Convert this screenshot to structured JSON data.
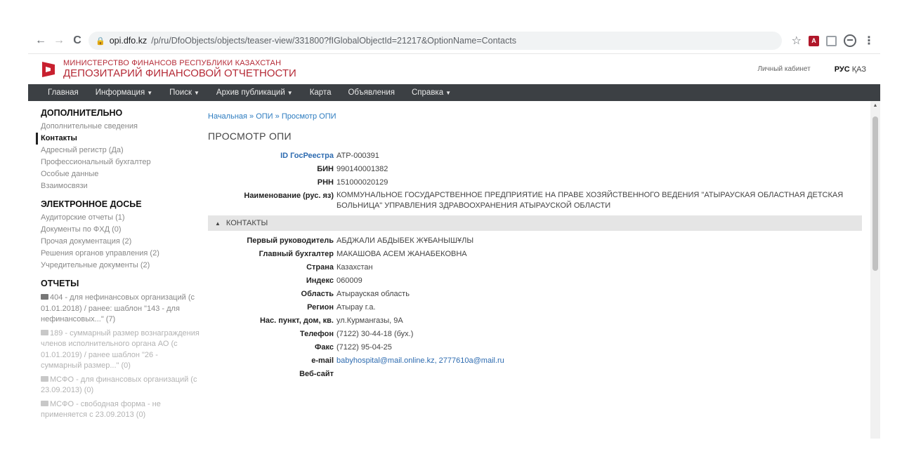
{
  "browser": {
    "url_host": "opi.dfo.kz",
    "url_path": "/p/ru/DfoObjects/objects/teaser-view/331800?fIGlobalObjectId=21217&OptionName=Contacts",
    "back_glyph": "←",
    "forward_glyph": "→",
    "reload_glyph": "C",
    "star_glyph": "☆",
    "kebab_glyph": "⋮"
  },
  "header": {
    "ministry": "МИНИСТЕРСТВО ФИНАНСОВ РЕСПУБЛИКИ КАЗАХСТАН",
    "depository": "ДЕПОЗИТАРИЙ ФИНАНСОВОЙ ОТЧЕТНОСТИ",
    "cabinet": "Личный кабинет",
    "lang_ru": "РУС",
    "lang_kz": "ҚАЗ",
    "brand_color": "#b52a36"
  },
  "menu": {
    "home": "Главная",
    "info": "Информация",
    "search": "Поиск",
    "archive": "Архив публикаций",
    "map": "Карта",
    "ads": "Объявления",
    "help": "Справка",
    "bg_color": "#3c4044"
  },
  "sidebar": {
    "additional_title": "ДОПОЛНИТЕЛЬНО",
    "additional_items": [
      "Дополнительные сведения",
      "Контакты",
      "Адресный регистр (Да)",
      "Профессиональный бухгалтер",
      "Особые данные",
      "Взаимосвязи"
    ],
    "dossier_title": "ЭЛЕКТРОННОЕ ДОСЬЕ",
    "dossier_items": [
      "Аудиторские отчеты (1)",
      "Документы по ФХД (0)",
      "Прочая документация (2)",
      "Решения органов управления (2)",
      "Учредительные документы (2)"
    ],
    "reports_title": "ОТЧЕТЫ",
    "reports": [
      "404 - для нефинансовых организаций (с 01.01.2018) / ранее: шаблон \"143 - для нефинансовых...\" (7)",
      "189 - суммарный размер вознаграждения членов исполнительного органа АО (с 01.01.2019) / ранее шаблон \"26 - суммарный размер...\" (0)",
      "МСФО - для финансовых организаций (с 23.09.2013) (0)",
      "МСФО - свободная форма - не применяется с 23.09.2013 (0)"
    ]
  },
  "main": {
    "breadcrumb": [
      "Начальная",
      "ОПИ",
      "Просмотр ОПИ"
    ],
    "breadcrumb_sep": "»",
    "title": "ПРОСМОТР ОПИ",
    "props": [
      {
        "k": "ID ГосРеестра",
        "v": "АТР-000391"
      },
      {
        "k": "БИН",
        "v": "990140001382"
      },
      {
        "k": "РНН",
        "v": "151000020129"
      },
      {
        "k": "Наименование (рус. яз)",
        "v": "КОММУНАЛЬНОЕ ГОСУДАРСТВЕННОЕ ПРЕДПРИЯТИЕ НА ПРАВЕ ХОЗЯЙСТВЕННОГО ВЕДЕНИЯ \"АТЫРАУСКАЯ ОБЛАСТНАЯ ДЕТСКАЯ БОЛЬНИЦА\" УПРАВЛЕНИЯ ЗДРАВООХРАНЕНИЯ АТЫРАУСКОЙ ОБЛАСТИ"
      }
    ],
    "contacts_label": "КОНТАКТЫ",
    "contacts_toggle": "▲",
    "contacts": [
      {
        "k": "Первый руководитель",
        "v": "АБДЖАЛИ АБДЫБЕК ЖҰБАНЫШҰЛЫ"
      },
      {
        "k": "Главный бухгалтер",
        "v": "МАКАШОВА АСЕМ ЖАНАБЕКОВНА"
      },
      {
        "k": "Страна",
        "v": "Казахстан"
      },
      {
        "k": "Индекс",
        "v": "060009"
      },
      {
        "k": "Область",
        "v": "Атырауская область"
      },
      {
        "k": "Регион",
        "v": "Атырау г.а."
      },
      {
        "k": "Нас. пункт, дом, кв.",
        "v": "ул.Курмангазы, 9А"
      },
      {
        "k": "Телефон",
        "v": "(7122) 30-44-18 (бух.)"
      },
      {
        "k": "Факс",
        "v": "(7122) 95-04-25"
      },
      {
        "k": "e-mail",
        "v": "babyhospital@mail.online.kz, 2777610a@mail.ru"
      },
      {
        "k": "Веб-сайт",
        "v": ""
      }
    ],
    "link_color": "#2d7cc0"
  }
}
